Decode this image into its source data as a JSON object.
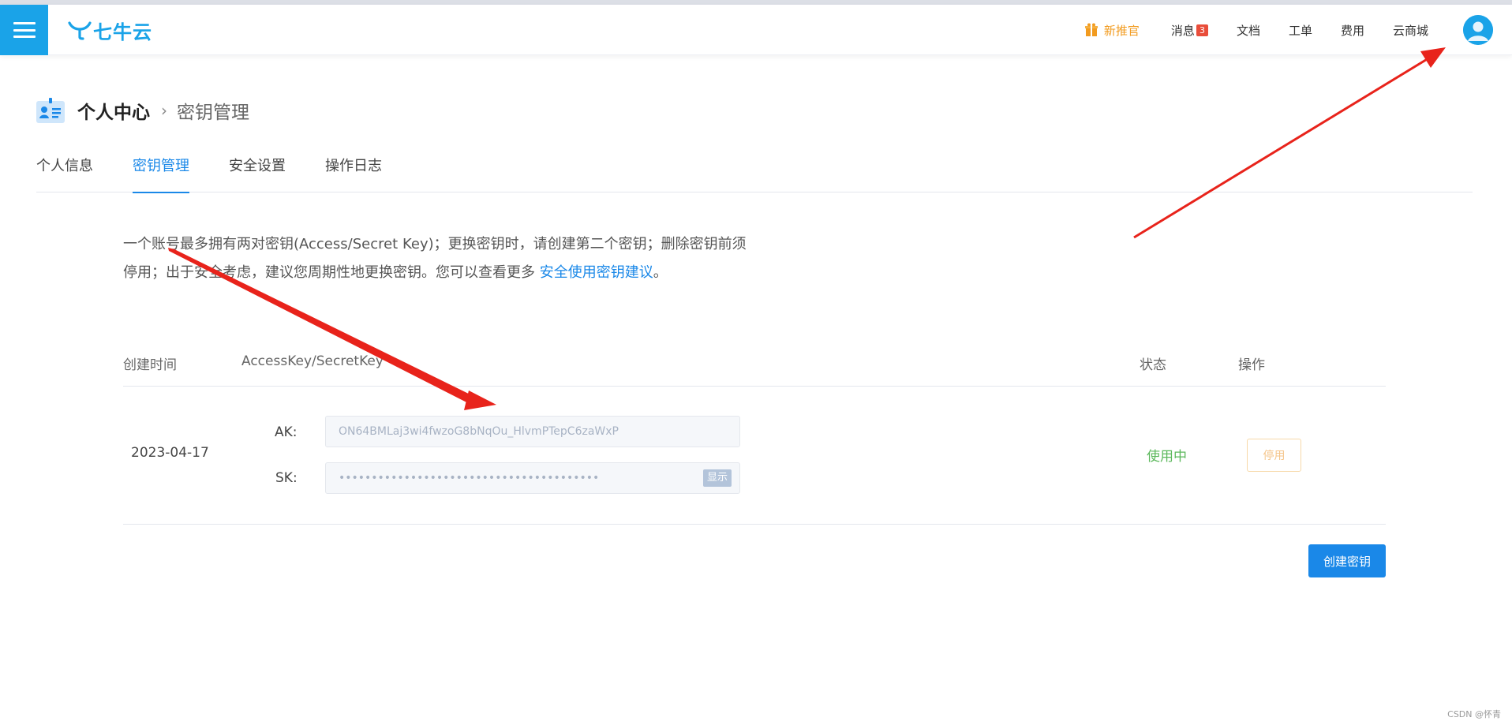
{
  "header": {
    "logo_text": "七牛云",
    "nav": {
      "promo": "新推官",
      "messages": "消息",
      "messages_count": "3",
      "docs": "文档",
      "tickets": "工单",
      "billing": "费用",
      "mall": "云商城"
    }
  },
  "breadcrumb": {
    "current": "个人中心",
    "separator": "›",
    "sub": "密钥管理"
  },
  "tabs": [
    {
      "label": "个人信息"
    },
    {
      "label": "密钥管理",
      "active": true
    },
    {
      "label": "安全设置"
    },
    {
      "label": "操作日志"
    }
  ],
  "notice": {
    "text": "一个账号最多拥有两对密钥(Access/Secret Key)；更换密钥时，请创建第二个密钥；删除密钥前须停用；出于安全考虑，建议您周期性地更换密钥。您可以查看更多 ",
    "link": "安全使用密钥建议",
    "tail": "。"
  },
  "table": {
    "columns": {
      "created": "创建时间",
      "keys": "AccessKey/SecretKey",
      "status": "状态",
      "actions": "操作"
    },
    "rows": [
      {
        "created": "2023-04-17",
        "ak_label": "AK:",
        "ak_value": "ON64BMLaj3wi4fwzoG8bNqOu_HlvmPTepC6zaWxP",
        "sk_label": "SK:",
        "sk_value": "••••••••••••••••••••••••••••••••••••••••",
        "show_label": "显示",
        "status": "使用中",
        "disable_label": "停用"
      }
    ]
  },
  "create_button": "创建密钥",
  "watermark": "CSDN @怀青",
  "colors": {
    "brand": "#1aa3e8",
    "primary": "#1a88e8",
    "promo": "#f29b1f",
    "success": "#5cb85c",
    "annotation_arrow": "#e8231b"
  }
}
